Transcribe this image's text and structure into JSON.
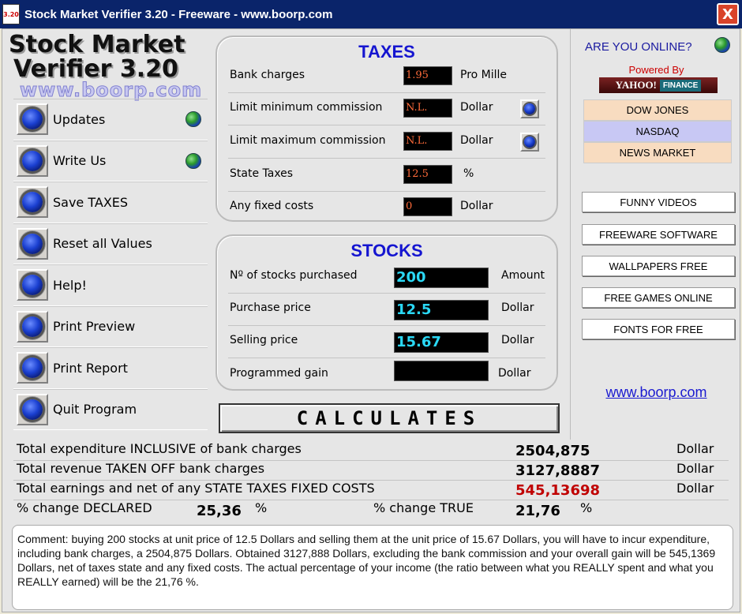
{
  "window": {
    "title": "Stock Market Verifier 3.20 - Freeware - www.boorp.com",
    "icon_text": "3.20",
    "close_label": "X"
  },
  "logo": {
    "line1": "Stock Market",
    "line2": "Verifier 3.20",
    "line3": "www.boorp.com"
  },
  "menu": [
    {
      "label": "Updates",
      "globe": true
    },
    {
      "label": "Write Us",
      "globe": true
    },
    {
      "label": "Save TAXES",
      "globe": false
    },
    {
      "label": "Reset all Values",
      "globe": false
    },
    {
      "label": "Help!",
      "globe": false
    },
    {
      "label": "Print Preview",
      "globe": false
    },
    {
      "label": "Print Report",
      "globe": false
    },
    {
      "label": "Quit Program",
      "globe": false
    }
  ],
  "taxes": {
    "title": "TAXES",
    "rows": [
      {
        "label": "Bank charges",
        "value": "1.95",
        "unit": "Pro Mille"
      },
      {
        "label": "Limit minimum commission",
        "value": "N.L.",
        "unit": "Dollar"
      },
      {
        "label": "Limit maximum commission",
        "value": "N.L.",
        "unit": "Dollar"
      },
      {
        "label": "State Taxes",
        "value": "12.5",
        "unit": "%"
      },
      {
        "label": "Any fixed costs",
        "value": "0",
        "unit": "Dollar"
      }
    ]
  },
  "stocks": {
    "title": "STOCKS",
    "rows": [
      {
        "label": "Nº of stocks purchased",
        "value": "200",
        "unit": "Amount"
      },
      {
        "label": "Purchase price",
        "value": "12.5",
        "unit": "Dollar"
      },
      {
        "label": "Selling price",
        "value": "15.67",
        "unit": "Dollar"
      },
      {
        "label": "Programmed gain",
        "value": "",
        "unit": "Dollar"
      }
    ]
  },
  "calculate_label": "CALCULATES",
  "right": {
    "online": "ARE YOU ONLINE?",
    "powered": "Powered By",
    "yahoo": "YAHOO!",
    "finance": "FINANCE",
    "markets": [
      {
        "label": "DOW JONES",
        "color": "#f8dcc0"
      },
      {
        "label": "NASDAQ",
        "color": "#c8c8f4"
      },
      {
        "label": "NEWS MARKET",
        "color": "#f8dcc0"
      }
    ],
    "links": [
      "FUNNY VIDEOS",
      "FREEWARE SOFTWARE",
      "WALLPAPERS FREE",
      "FREE GAMES ONLINE",
      "FONTS FOR FREE"
    ],
    "website": "www.boorp.com"
  },
  "results": {
    "rows": [
      {
        "label": "Total expenditure INCLUSIVE of bank charges",
        "value": "2504,875",
        "unit": "Dollar",
        "red": false
      },
      {
        "label": "Total revenue TAKEN OFF bank charges",
        "value": "3127,8887",
        "unit": "Dollar",
        "red": false
      },
      {
        "label": "Total earnings and net of any STATE TAXES FIXED COSTS",
        "value": "545,13698",
        "unit": "Dollar",
        "red": true
      }
    ],
    "declared_label": "% change DECLARED",
    "declared_value": "25,36",
    "true_label": "% change TRUE",
    "true_value": "21,76",
    "pct_sign": "%"
  },
  "comment": "Comment: buying 200 stocks at unit price of 12.5 Dollars and selling them at the unit price of 15.67 Dollars, you will have to incur expenditure, including bank charges, a 2504,875 Dollars. Obtained 3127,888 Dollars, excluding the bank commission and your overall gain will be 545,1369 Dollars, net of taxes state and any fixed costs. The actual percentage of your income (the ratio between what you REALLY spent and what you REALLY earned) will be the 21,76 %."
}
